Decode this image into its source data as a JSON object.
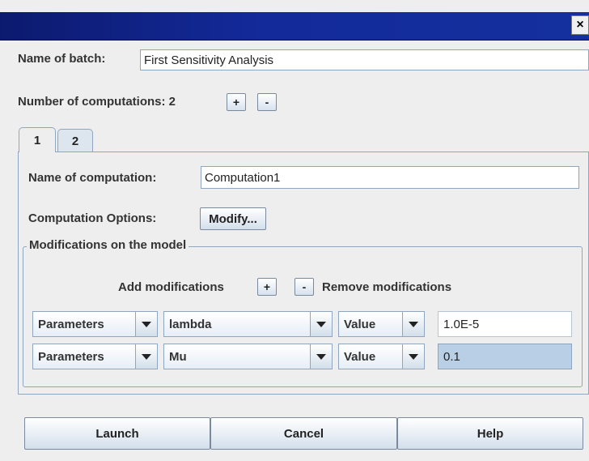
{
  "window": {
    "title": "",
    "close_glyph": "×"
  },
  "batch": {
    "name_label": "Name of batch:",
    "name_value": "First Sensitivity Analysis"
  },
  "computations": {
    "count_label": "Number of computations: 2",
    "add_label": "+",
    "remove_label": "-"
  },
  "tabs": [
    {
      "label": "1"
    },
    {
      "label": "2"
    }
  ],
  "computation": {
    "name_label": "Name of computation:",
    "name_value": "Computation1",
    "options_label": "Computation Options:",
    "modify_label": "Modify..."
  },
  "modifications": {
    "group_title": "Modifications on the model",
    "add_label": "Add modifications",
    "add_button": "+",
    "remove_button": "-",
    "remove_label": "Remove modifications",
    "rows": [
      {
        "category": "Parameters",
        "name": "lambda",
        "type": "Value",
        "value": "1.0E-5",
        "selected": false
      },
      {
        "category": "Parameters",
        "name": "Mu",
        "type": "Value",
        "value": "0.1",
        "selected": true
      }
    ]
  },
  "footer": {
    "launch_label": "Launch",
    "cancel_label": "Cancel",
    "help_label": "Help"
  },
  "colors": {
    "titlebar": "#132a9a",
    "selection": "#b8cfe6",
    "border": "#8ea6c0"
  },
  "icons": {
    "close": "close-icon",
    "dropdown": "chevron-down-icon"
  }
}
